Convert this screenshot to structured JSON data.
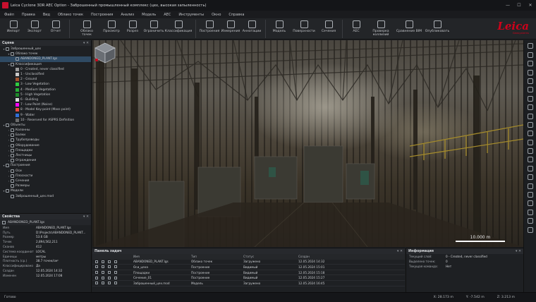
{
  "window": {
    "title": "Leica Cyclone 3DR AEC Option - Заброшенный промышленный комплекс (цех, высокая запыленность)",
    "controls": [
      "—",
      "☐",
      "✕"
    ]
  },
  "menu": [
    "Файл",
    "Правка",
    "Вид",
    "Облако точек",
    "Построения",
    "Анализ",
    "Модель",
    "AEC",
    "Инструменты",
    "Окно",
    "Справка"
  ],
  "ribbon": [
    {
      "label": "Импорт"
    },
    {
      "label": "Экспорт"
    },
    {
      "label": "Отчет"
    },
    {
      "sep": true
    },
    {
      "label": "Облако\nточек"
    },
    {
      "label": "Просмотр"
    },
    {
      "label": "Разрез"
    },
    {
      "label": "Ограничить"
    },
    {
      "label": "Классификация"
    },
    {
      "sep": true
    },
    {
      "label": "Построения"
    },
    {
      "label": "Измерения"
    },
    {
      "label": "Аннотации"
    },
    {
      "sep": true
    },
    {
      "label": "Модель"
    },
    {
      "label": "Поверхности"
    },
    {
      "label": "Сечения"
    },
    {
      "sep": true
    },
    {
      "label": "AEC"
    },
    {
      "label": "Проверка\nколлизий"
    },
    {
      "label": "Сравнение BIM"
    },
    {
      "label": "Опубликовать"
    }
  ],
  "logo": {
    "brand": "Leica",
    "sub": "Geosystems"
  },
  "scene": {
    "title": "Сцена",
    "tree": [
      {
        "label": "Заброшенный_цех",
        "depth": 0,
        "caret": "▾"
      },
      {
        "label": "Облако точек",
        "depth": 1,
        "caret": "▾"
      },
      {
        "label": "ABANDONED_PLANT.lgs",
        "depth": 2,
        "caret": "",
        "selected": true
      },
      {
        "label": "Классификация",
        "depth": 1,
        "caret": "▾"
      },
      {
        "label": "0 - Created, never classified",
        "depth": 2,
        "swatch": "#9a9a9a"
      },
      {
        "label": "1 - Unclassified",
        "depth": 2,
        "swatch": "#c8c8c8"
      },
      {
        "label": "2 - Ground",
        "depth": 2,
        "swatch": "#a0522d"
      },
      {
        "label": "3 - Low Vegetation",
        "depth": 2,
        "swatch": "#2ecc40"
      },
      {
        "label": "4 - Medium Vegetation",
        "depth": 2,
        "swatch": "#27ae36"
      },
      {
        "label": "5 - High Vegetation",
        "depth": 2,
        "swatch": "#1e8a2a"
      },
      {
        "label": "6 - Building",
        "depth": 2,
        "swatch": "#d9d9d9"
      },
      {
        "label": "7 - Low Point (Noise)",
        "depth": 2,
        "swatch": "#ff00ff"
      },
      {
        "label": "8 - Model Key-point (Mass point)",
        "depth": 2,
        "swatch": "#e74c3c"
      },
      {
        "label": "9 - Water",
        "depth": 2,
        "swatch": "#2f6fd6"
      },
      {
        "label": "10 - Reserved for ASPRS Definition",
        "depth": 2,
        "swatch": "#6b6b6b"
      },
      {
        "label": "Объекты",
        "depth": 0,
        "caret": "▾"
      },
      {
        "label": "Колонны",
        "depth": 1,
        "caret": "›"
      },
      {
        "label": "Балки",
        "depth": 1,
        "caret": "›"
      },
      {
        "label": "Трубопроводы",
        "depth": 1,
        "caret": "›"
      },
      {
        "label": "Оборудование",
        "depth": 1,
        "caret": "›"
      },
      {
        "label": "Площадки",
        "depth": 1,
        "caret": "›"
      },
      {
        "label": "Лестницы",
        "depth": 1,
        "caret": "›"
      },
      {
        "label": "Ограждения",
        "depth": 1,
        "caret": "›"
      },
      {
        "label": "Построения",
        "depth": 0,
        "caret": "▾"
      },
      {
        "label": "Оси",
        "depth": 1,
        "caret": "›"
      },
      {
        "label": "Плоскости",
        "depth": 1,
        "caret": "›"
      },
      {
        "label": "Сечения",
        "depth": 1,
        "caret": "›"
      },
      {
        "label": "Размеры",
        "depth": 1,
        "caret": ""
      },
      {
        "label": "Модели",
        "depth": 0,
        "caret": "▾"
      },
      {
        "label": "Заброшенный_цех.mod",
        "depth": 1,
        "caret": ""
      }
    ]
  },
  "properties": {
    "title": "Свойства",
    "object": "ABANDONED_PLANT.lgs",
    "rows": [
      {
        "k": "Имя",
        "v": "ABANDONED_PLANT.lgs"
      },
      {
        "k": "Путь",
        "v": "D:\\Projects\\ABANDONED_PLANT..."
      },
      {
        "k": "Размер",
        "v": "53.6 GB"
      },
      {
        "k": "Точек",
        "v": "2,894,562,211"
      },
      {
        "k": "Сканов",
        "v": "412"
      },
      {
        "k": "Система координат",
        "v": "LOCAL"
      },
      {
        "k": "Единицы",
        "v": "метры"
      },
      {
        "k": "Плотность (ср.)",
        "v": "38.7 точек/см²"
      },
      {
        "k": "Классифицировано",
        "v": "Да"
      },
      {
        "k": "Создан",
        "v": "12.05.2024 14:32"
      },
      {
        "k": "Изменен",
        "v": "12.05.2024 17:08"
      }
    ]
  },
  "viewport": {
    "scale_label": "10.000 m"
  },
  "tasks": {
    "title": "Панель задач",
    "headers": [
      "Имя",
      "Тип",
      "Статус",
      "Создан"
    ],
    "rows": [
      {
        "name": "ABANDONED_PLANT.lgs",
        "type": "Облако точек",
        "status": "Загружено",
        "created": "12.05.2024 14:32"
      },
      {
        "name": "Оси_цеха",
        "type": "Построение",
        "status": "Видимый",
        "created": "12.05.2024 15:01"
      },
      {
        "name": "Площадки",
        "type": "Построение",
        "status": "Видимый",
        "created": "12.05.2024 15:18"
      },
      {
        "name": "Сечение_01",
        "type": "Построение",
        "status": "Видимый",
        "created": "12.05.2024 15:27"
      },
      {
        "name": "Заброшенный_цех.mod",
        "type": "Модель",
        "status": "Загружено",
        "created": "12.05.2024 16:45"
      }
    ]
  },
  "info": {
    "title": "Информация",
    "rows": [
      {
        "k": "Текущий слой:",
        "v": "0 - Created, never classified"
      },
      {
        "k": "Выделено точек:",
        "v": "0"
      },
      {
        "k": "Текущая команда:",
        "v": "Нет"
      }
    ]
  },
  "status": {
    "ready": "Готово",
    "x": "X: 28.173 m",
    "y": "Y: -7.542 m",
    "z": "Z: 3.213 m"
  }
}
